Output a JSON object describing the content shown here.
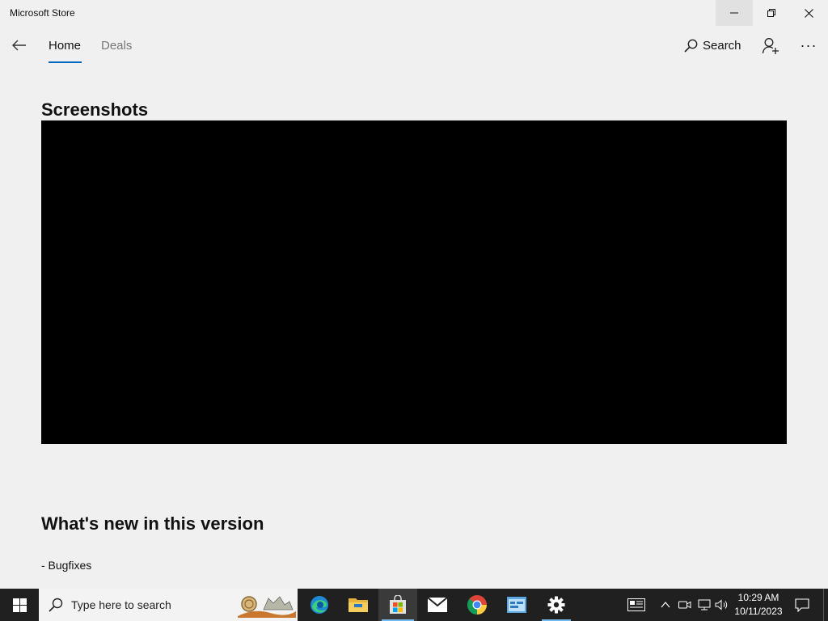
{
  "window": {
    "title": "Microsoft Store",
    "controls": {
      "minimize": "minimize-icon",
      "restore": "restore-icon",
      "close": "close-icon"
    }
  },
  "nav": {
    "back_icon": "back-arrow-icon",
    "tabs": [
      {
        "label": "Home",
        "selected": true
      },
      {
        "label": "Deals",
        "selected": false
      }
    ],
    "search_label": "Search",
    "account_icon": "add-account-icon",
    "more_label": "···"
  },
  "content": {
    "screenshots_heading": "Screenshots",
    "whats_new_heading": "What's new in this version",
    "release_notes": "- Bugfixes"
  },
  "taskbar": {
    "search_placeholder": "Type here to search",
    "apps": [
      {
        "name": "Microsoft Edge",
        "icon": "edge-icon"
      },
      {
        "name": "File Explorer",
        "icon": "folder-icon"
      },
      {
        "name": "Microsoft Store",
        "icon": "store-icon",
        "active": true
      },
      {
        "name": "Mail",
        "icon": "mail-icon"
      },
      {
        "name": "Google Chrome",
        "icon": "chrome-icon"
      },
      {
        "name": "Control Panel",
        "icon": "control-panel-icon"
      },
      {
        "name": "Settings",
        "icon": "gear-icon",
        "running": true
      }
    ],
    "clock": {
      "time": "10:29 AM",
      "date": "10/11/2023"
    }
  },
  "colors": {
    "accent": "#0067c0",
    "window_bg": "#f0f0f0",
    "taskbar_bg": "#202020",
    "screenshot_bg": "#000000"
  }
}
